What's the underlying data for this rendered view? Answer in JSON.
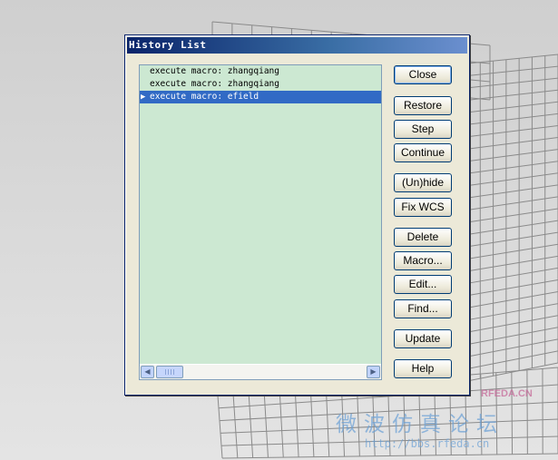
{
  "dialog": {
    "title": "History List"
  },
  "history": {
    "items": [
      {
        "text": "execute macro: zhangqiang",
        "selected": false
      },
      {
        "text": "execute macro: zhangqiang",
        "selected": false
      },
      {
        "text": "execute macro: efield",
        "selected": true
      }
    ],
    "current_marker": "▶"
  },
  "buttons": {
    "close": "Close",
    "restore": "Restore",
    "step": "Step",
    "continue": "Continue",
    "unhide": "(Un)hide",
    "fix_wcs": "Fix WCS",
    "delete": "Delete",
    "macro": "Macro...",
    "edit": "Edit...",
    "find": "Find...",
    "update": "Update",
    "help": "Help"
  },
  "scrollbar": {
    "left_arrow": "◀",
    "right_arrow": "▶"
  },
  "watermark": {
    "logo": "RFEDA.CN",
    "chinese": "微波仿真论坛",
    "url": "http://bbs.rfeda.cn"
  },
  "colors": {
    "list_background": "#cce8d2",
    "selection": "#316ac5",
    "title_bar": "#0a246a"
  }
}
